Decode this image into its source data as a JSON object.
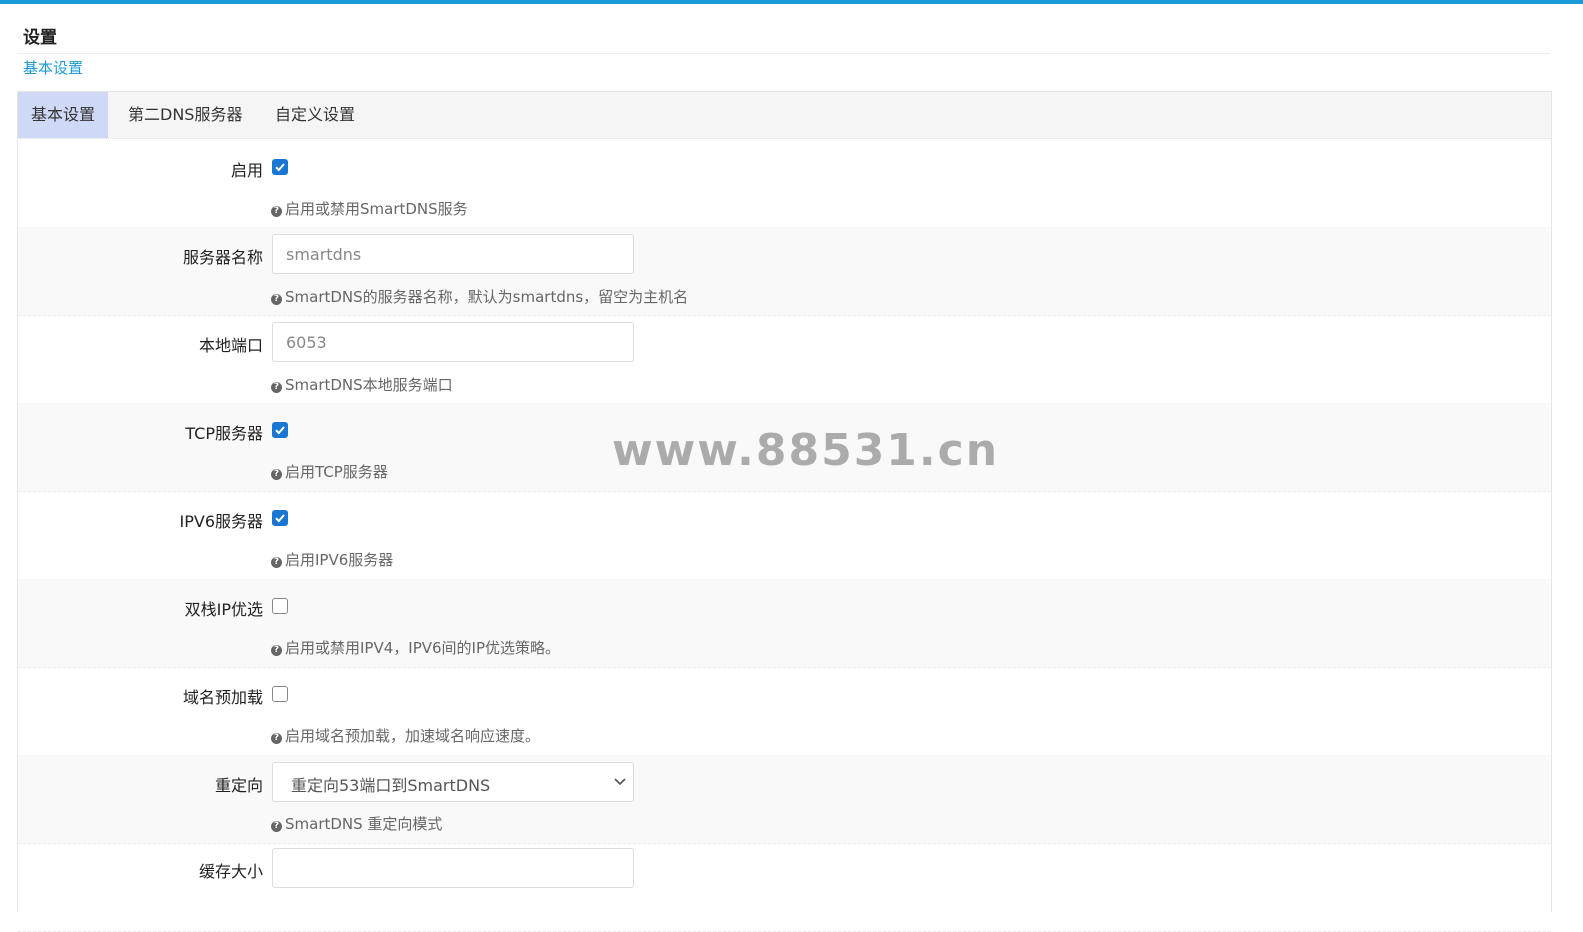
{
  "header": {
    "title": "设置",
    "subtitle": "基本设置"
  },
  "tabs": [
    {
      "label": "基本设置",
      "active": true
    },
    {
      "label": "第二DNS服务器",
      "active": false
    },
    {
      "label": "自定义设置",
      "active": false
    }
  ],
  "form": {
    "enable": {
      "label": "启用",
      "checked": true,
      "help": "启用或禁用SmartDNS服务"
    },
    "server_name": {
      "label": "服务器名称",
      "placeholder": "smartdns",
      "value": "",
      "help": "SmartDNS的服务器名称，默认为smartdns，留空为主机名"
    },
    "local_port": {
      "label": "本地端口",
      "placeholder": "6053",
      "value": "",
      "help": "SmartDNS本地服务端口"
    },
    "tcp_server": {
      "label": "TCP服务器",
      "checked": true,
      "help": "启用TCP服务器"
    },
    "ipv6_server": {
      "label": "IPV6服务器",
      "checked": true,
      "help": "启用IPV6服务器"
    },
    "dualstack": {
      "label": "双栈IP优选",
      "checked": false,
      "help": "启用或禁用IPV4，IPV6间的IP优选策略。"
    },
    "prefetch": {
      "label": "域名预加载",
      "checked": false,
      "help": "启用域名预加载，加速域名响应速度。"
    },
    "redirect": {
      "label": "重定向",
      "selected": "重定向53端口到SmartDNS",
      "help": "SmartDNS 重定向模式"
    },
    "cache_size": {
      "label": "缓存大小",
      "value": ""
    }
  },
  "watermark": "www.88531.cn",
  "colors": {
    "accent": "#1a9bd7",
    "checkbox": "#1976d2",
    "active_tab": "#cfd8f5"
  }
}
